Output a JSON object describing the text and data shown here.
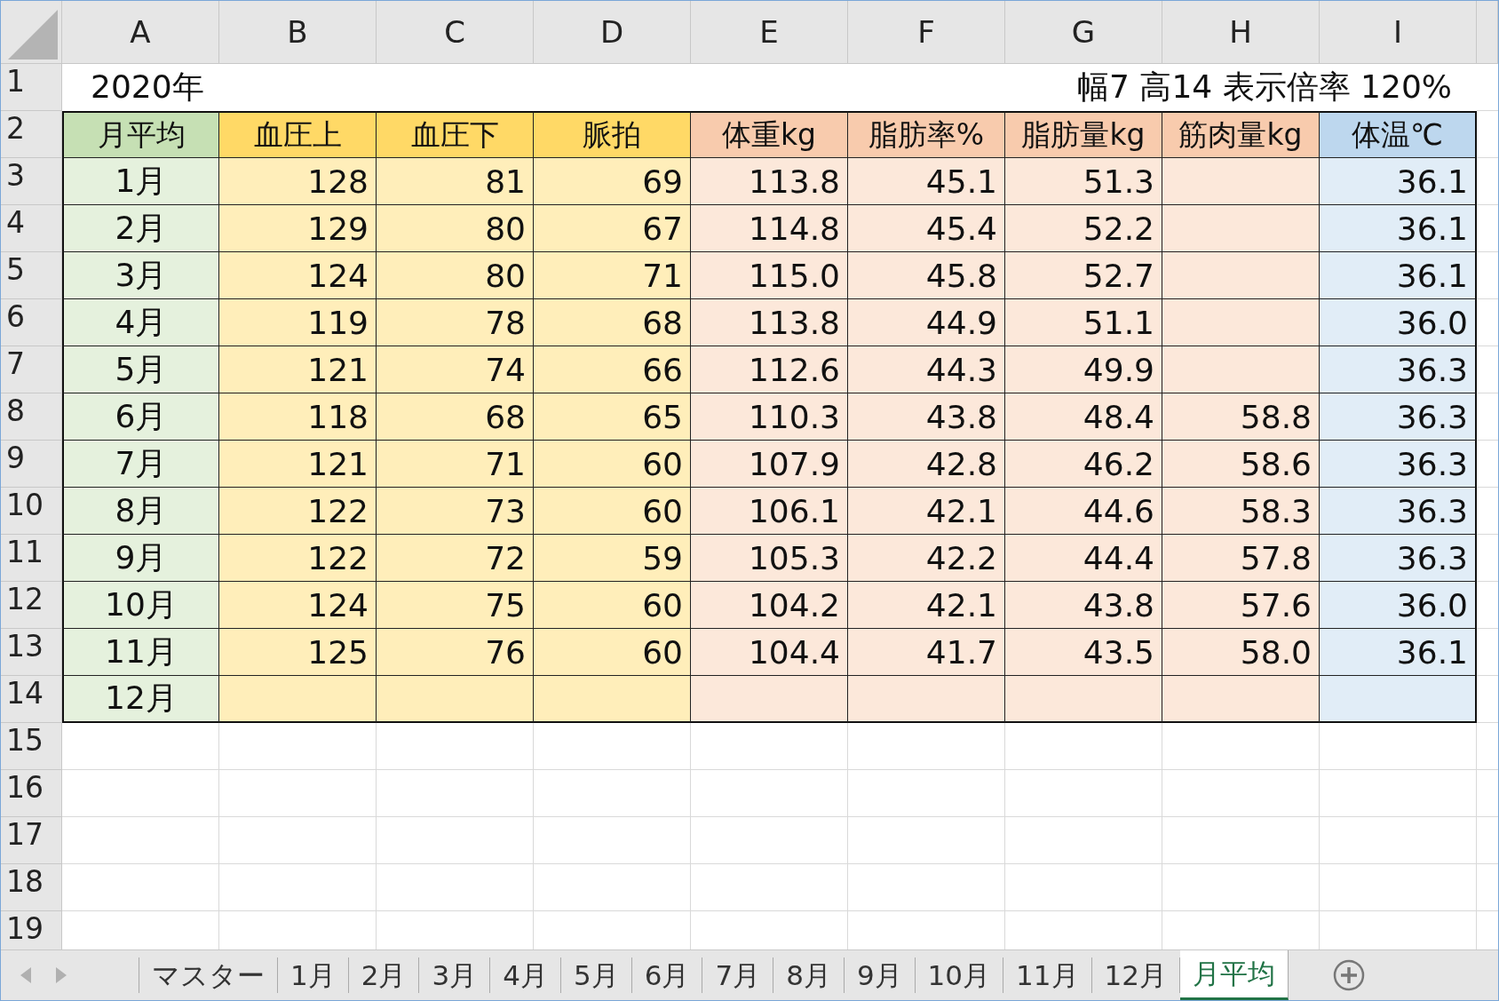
{
  "column_letters": [
    "A",
    "B",
    "C",
    "D",
    "E",
    "F",
    "G",
    "H",
    "I"
  ],
  "row_numbers": [
    "1",
    "2",
    "3",
    "4",
    "5",
    "6",
    "7",
    "8",
    "9",
    "10",
    "11",
    "12",
    "13",
    "14",
    "15",
    "16",
    "17",
    "18",
    "19"
  ],
  "title_row": {
    "left": "2020年",
    "right": "幅7 高14 表示倍率 120%"
  },
  "table": {
    "columns": [
      {
        "header": "月平均",
        "color": "#c6e0b4"
      },
      {
        "header": "血圧上",
        "color": "#ffd966"
      },
      {
        "header": "血圧下",
        "color": "#ffd966"
      },
      {
        "header": "脈拍",
        "color": "#ffd966"
      },
      {
        "header": "体重kg",
        "color": "#f8cbad"
      },
      {
        "header": "脂肪率%",
        "color": "#f8cbad"
      },
      {
        "header": "脂肪量kg",
        "color": "#f8cbad"
      },
      {
        "header": "筋肉量kg",
        "color": "#f8cbad"
      },
      {
        "header": "体温℃",
        "color": "#bdd7ee"
      }
    ],
    "rows": [
      [
        "1月",
        "128",
        "81",
        "69",
        "113.8",
        "45.1",
        "51.3",
        null,
        "36.1"
      ],
      [
        "2月",
        "129",
        "80",
        "67",
        "114.8",
        "45.4",
        "52.2",
        null,
        "36.1"
      ],
      [
        "3月",
        "124",
        "80",
        "71",
        "115.0",
        "45.8",
        "52.7",
        null,
        "36.1"
      ],
      [
        "4月",
        "119",
        "78",
        "68",
        "113.8",
        "44.9",
        "51.1",
        null,
        "36.0"
      ],
      [
        "5月",
        "121",
        "74",
        "66",
        "112.6",
        "44.3",
        "49.9",
        null,
        "36.3"
      ],
      [
        "6月",
        "118",
        "68",
        "65",
        "110.3",
        "43.8",
        "48.4",
        "58.8",
        "36.3"
      ],
      [
        "7月",
        "121",
        "71",
        "60",
        "107.9",
        "42.8",
        "46.2",
        "58.6",
        "36.3"
      ],
      [
        "8月",
        "122",
        "73",
        "60",
        "106.1",
        "42.1",
        "44.6",
        "58.3",
        "36.3"
      ],
      [
        "9月",
        "122",
        "72",
        "59",
        "105.3",
        "42.2",
        "44.4",
        "57.8",
        "36.3"
      ],
      [
        "10月",
        "124",
        "75",
        "60",
        "104.2",
        "42.1",
        "43.8",
        "57.6",
        "36.0"
      ],
      [
        "11月",
        "125",
        "76",
        "60",
        "104.4",
        "41.7",
        "43.5",
        "58.0",
        "36.1"
      ],
      [
        "12月",
        null,
        null,
        null,
        null,
        null,
        null,
        null,
        null
      ]
    ]
  },
  "sheet_tabs": [
    {
      "label": "マスター",
      "selected": false
    },
    {
      "label": "1月",
      "selected": false
    },
    {
      "label": "2月",
      "selected": false
    },
    {
      "label": "3月",
      "selected": false
    },
    {
      "label": "4月",
      "selected": false
    },
    {
      "label": "5月",
      "selected": false
    },
    {
      "label": "6月",
      "selected": false
    },
    {
      "label": "7月",
      "selected": false
    },
    {
      "label": "8月",
      "selected": false
    },
    {
      "label": "9月",
      "selected": false
    },
    {
      "label": "10月",
      "selected": false
    },
    {
      "label": "11月",
      "selected": false
    },
    {
      "label": "12月",
      "selected": false
    },
    {
      "label": "月平均",
      "selected": true
    }
  ]
}
